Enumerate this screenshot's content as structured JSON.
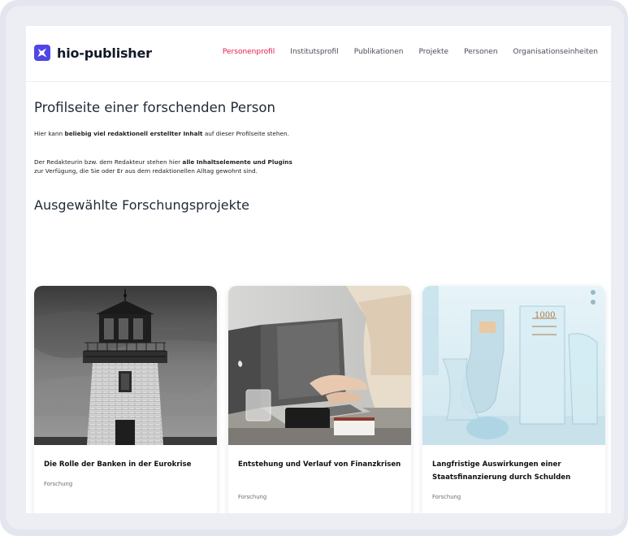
{
  "header": {
    "logo_text": "hio-publisher",
    "nav": [
      {
        "label": "Personenprofil",
        "active": true
      },
      {
        "label": "Institutsprofil",
        "active": false
      },
      {
        "label": "Publikationen",
        "active": false
      },
      {
        "label": "Projekte",
        "active": false
      },
      {
        "label": "Personen",
        "active": false
      },
      {
        "label": "Organisationseinheiten",
        "active": false
      }
    ]
  },
  "main": {
    "title": "Profilseite einer forschenden Person",
    "intro": {
      "pre": "Hier kann ",
      "bold": "beliebig viel redaktionell erstellter Inhalt",
      "post": " auf dieser Profilseite stehen."
    },
    "intro2": {
      "line1_pre": "Der Redakteurin bzw. dem Redakteur stehen hier ",
      "line1_bold": "alle Inhaltselemente und Plugins",
      "line2": "zur Verfügung, die Sie oder Er aus dem redaktionellen Alltag gewohnt sind."
    },
    "projects_heading": "Ausgewählte Forschungsprojekte",
    "projects": [
      {
        "title": "Die Rolle der Banken in der Eurokrise",
        "tag": "Forschung",
        "image": "lighthouse-photo"
      },
      {
        "title": "Entstehung und Verlauf von Finanzkrisen",
        "tag": "Forschung",
        "image": "laptop-photo"
      },
      {
        "title": "Langfristige Auswirkungen einer Staatsfinanzierung durch Schulden",
        "tag": "Forschung",
        "image": "lab-glassware-photo"
      }
    ]
  },
  "colors": {
    "accent": "#e11d48",
    "brand": "#4f46e5",
    "frame": "#e4e6ef"
  }
}
